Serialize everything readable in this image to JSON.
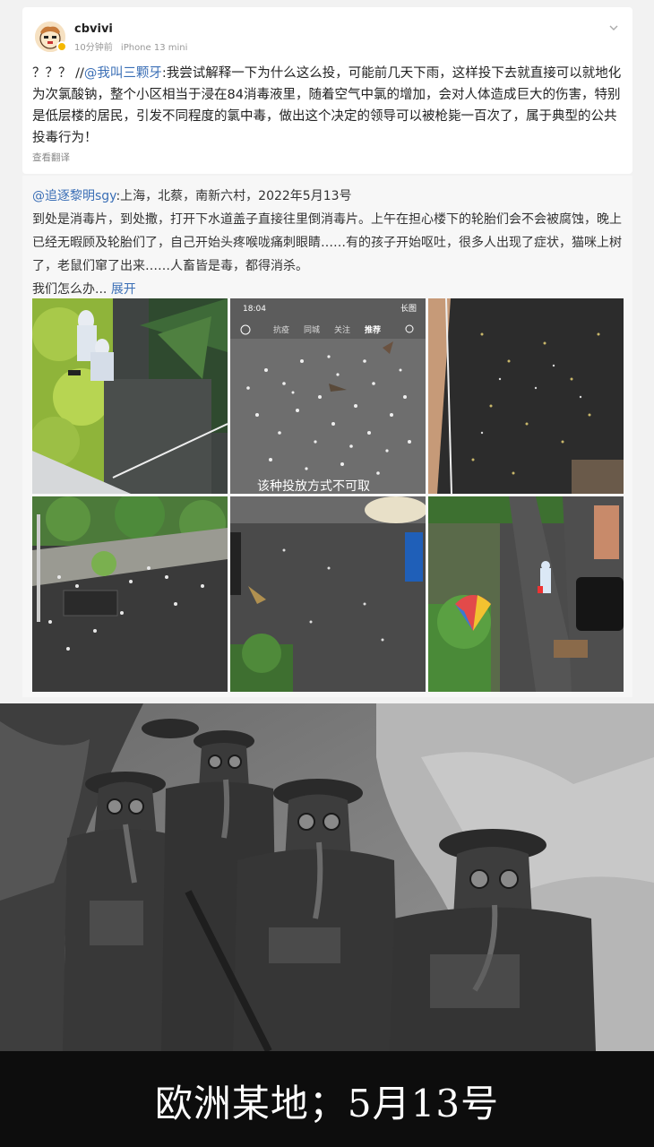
{
  "post": {
    "username": "cbvivi",
    "time": "10分钟前",
    "device": "iPhone 13 mini",
    "text_prefix": "？？？ //",
    "mention": "@我叫三颗牙",
    "text_body": ":我尝试解释一下为什么这么投，可能前几天下雨，这样投下去就直接可以就地化为次氯酸钠，整个小区相当于浸在84消毒液里，随着空气中氯的增加，会对人体造成巨大的伤害，特别是低层楼的居民，引发不同程度的氯中毒，做出这个决定的领导可以被枪毙一百次了，属于典型的公共投毒行为！",
    "translate": "查看翻译"
  },
  "repost": {
    "mention": "@追逐黎明sgy",
    "location_line": ":上海，北蔡，南新六村，2022年5月13号",
    "body": "到处是消毒片，到处撒，打开下水道盖子直接往里倒消毒片。上午在担心楼下的轮胎们会不会被腐蚀，晚上已经无暇顾及轮胎们了，自己开始头疼喉咙痛刺眼睛……有的孩子开始呕吐，很多人出现了症状，猫咪上树了，老鼠们窜了出来……人畜皆是毒，都得消杀。",
    "last_line": "我们怎么办...",
    "expand": "展开"
  },
  "photo2_overlay": {
    "time": "18:04",
    "badge": "长图",
    "tabs": [
      "抗疫",
      "同城",
      "关注",
      "推荐"
    ],
    "subtitle": "该种投放方式不可取"
  },
  "caption": "欧洲某地；5月13号",
  "icons": {
    "chevron": "chevron-down-icon",
    "verified": "verified-badge-icon",
    "avatar": "avatar-cartoon-icon"
  },
  "colors": {
    "link": "#3b6fb6",
    "badge": "#f5b800"
  }
}
